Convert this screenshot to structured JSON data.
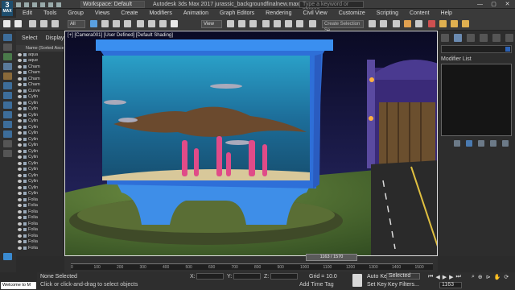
{
  "app": {
    "logo_text": "3",
    "logo_sub": "MAX",
    "workspace": "Workspace: Default",
    "title": "Autodesk 3ds Max 2017    jurassic_backgroundfinalnew.max",
    "search_placeholder": "Type a keyword or phrase",
    "window_controls": [
      "—",
      "▢",
      "✕"
    ]
  },
  "menu": [
    "Edit",
    "Tools",
    "Group",
    "Views",
    "Create",
    "Modifiers",
    "Animation",
    "Graph Editors",
    "Rendering",
    "Civil View",
    "Customize",
    "Scripting",
    "Content",
    "Help"
  ],
  "toolbar": {
    "filter": "All",
    "view": "View",
    "selection_set": "Create Selection Se"
  },
  "sidebar": {
    "tabs": [
      "Select",
      "Display"
    ],
    "header": "Name (Sorted Ascen",
    "items": [
      "aqua",
      "aque",
      "Cham",
      "Cham",
      "Cham",
      "Cham",
      "Curve",
      "Cylin",
      "Cylin",
      "Cylin",
      "Cylin",
      "Cylin",
      "Cylin",
      "Cylin",
      "Cylin",
      "Cylin",
      "Cylin",
      "Cylin",
      "Cylin",
      "Cylin",
      "Cylin",
      "Cylin",
      "Cylin",
      "Cylin",
      "Folia",
      "Folia",
      "Folia",
      "Folia",
      "Folia",
      "Folia",
      "Folia",
      "Folia",
      "Folia"
    ]
  },
  "viewport": {
    "label": "[+] [Camera001] [User Defined] [Default Shading]"
  },
  "right_panel": {
    "modifier_list_label": "Modifier List"
  },
  "timeline": {
    "frame": "1163 / 1570",
    "ticks": [
      "0",
      "100",
      "200",
      "300",
      "400",
      "500",
      "600",
      "700",
      "800",
      "900",
      "1000",
      "1100",
      "1200",
      "1300",
      "1400",
      "1500"
    ]
  },
  "status": {
    "welcome": "Welcome to M",
    "selection": "None Selected",
    "hint": "Click or click-and-drag to select objects",
    "x_label": "X:",
    "y_label": "Y:",
    "z_label": "Z:",
    "grid": "Grid = 10.0",
    "add_time_tag": "Add Time Tag",
    "auto_key": "Auto Key",
    "set_key": "Set Key",
    "selected": "Selected",
    "key_filters": "Key Filters...",
    "current_frame": "1163"
  }
}
